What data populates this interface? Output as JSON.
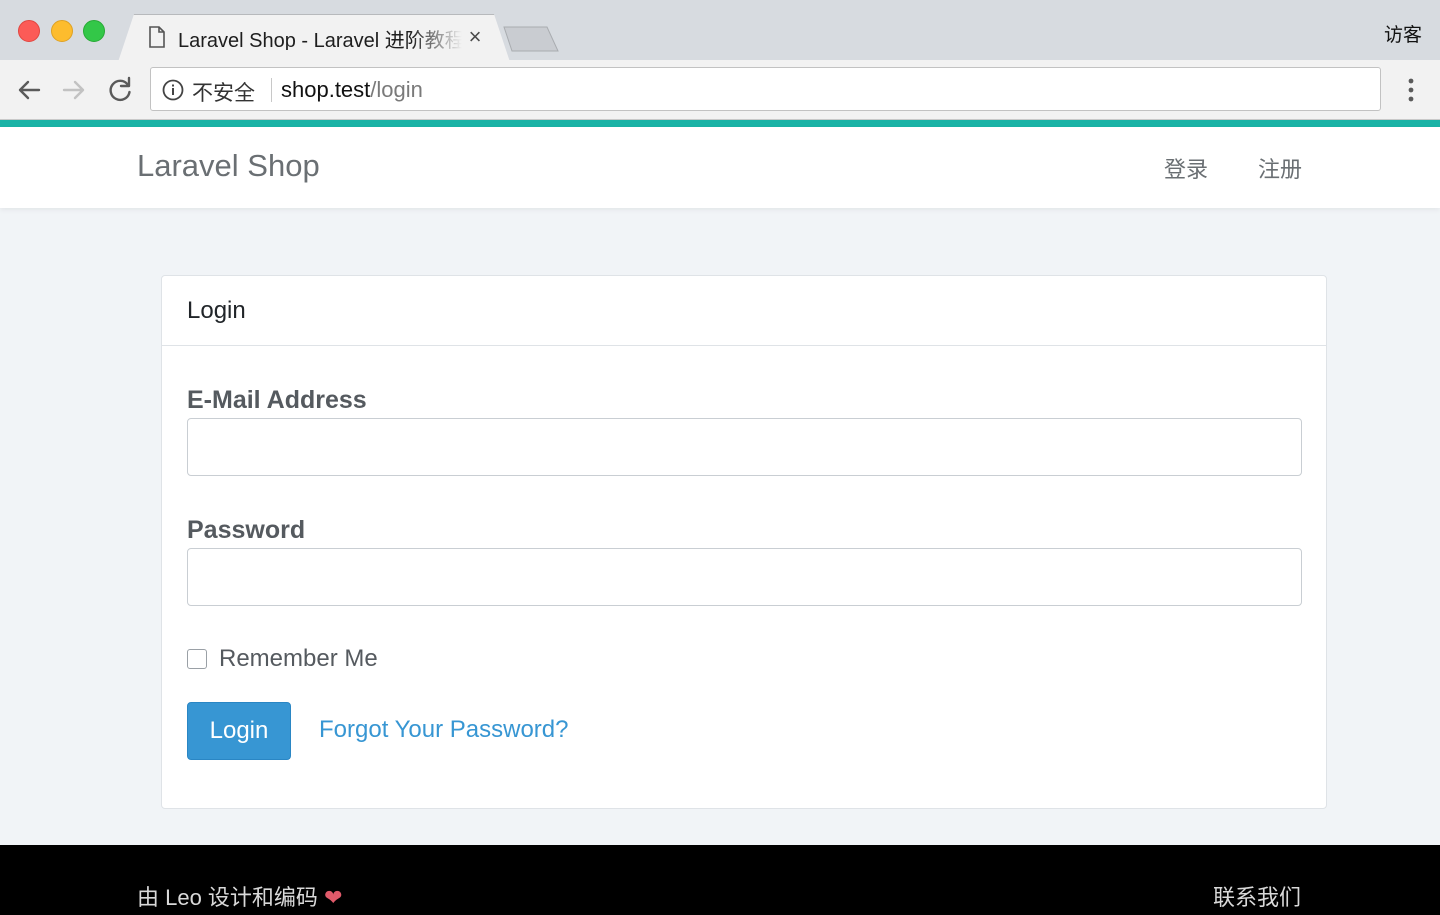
{
  "browser": {
    "tab_title": "Laravel Shop - Laravel 进阶教程",
    "tab_close": "×",
    "profile_label": "访客",
    "security_label": "不安全",
    "url_host": "shop.test",
    "url_path": "/login"
  },
  "navbar": {
    "brand": "Laravel Shop",
    "links": [
      "登录",
      "注册"
    ]
  },
  "login_card": {
    "header": "Login",
    "email_label": "E-Mail Address",
    "email_value": "",
    "password_label": "Password",
    "password_value": "",
    "remember_label": "Remember Me",
    "remember_checked": false,
    "submit_label": "Login",
    "forgot_label": "Forgot Your Password?"
  },
  "footer": {
    "credit": "由 Leo 设计和编码",
    "heart": "❤",
    "contact": "联系我们"
  },
  "colors": {
    "accent_bar": "#1ab3a6",
    "primary_button": "#3796d3",
    "link": "#3796d3",
    "heart": "#e05a6a"
  }
}
